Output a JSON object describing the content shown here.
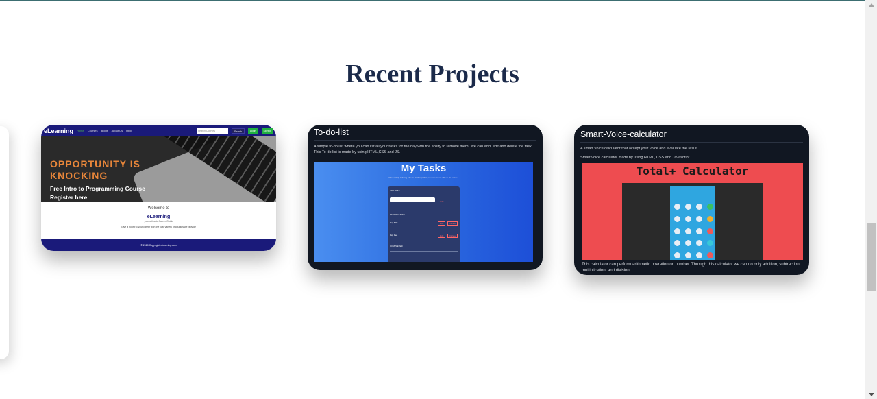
{
  "section": {
    "heading": "Recent Projects"
  },
  "projects": [
    {
      "id": "elearning",
      "screenshot": {
        "logo": "eLearning",
        "nav": [
          "Home",
          "Courses",
          "Blogs",
          "About Us",
          "Help"
        ],
        "search_placeholder": "Search Courses",
        "search_button": "Search",
        "login": "Login",
        "signup": "SignUp",
        "hero_title": "OPPORTUNITY IS KNOCKING",
        "hero_line1": "Free Intro to Programming Course",
        "hero_line2": "Register here",
        "welcome": "Welcome to",
        "brand": "eLearning",
        "tagline": "your ultimate Career Guide",
        "description": "Give a boost to your career with the vast variety of courses we provide",
        "footer": "© 2020 Copyright: eLearning.com"
      }
    },
    {
      "id": "todo",
      "title": "To-do-list",
      "description": "A simple to-do list where you can list all your tasks for the day with the ability to remove them. We can add, edit and delete the task. This To-do list is made by using HTML,CSS and JS.",
      "screenshot": {
        "title": "My Tasks",
        "subtitle": "Productivity is being able to do things that you were never able to do before.",
        "add_label": "ADD TASK",
        "add_button": "Add",
        "pending_label": "PENDING TASK",
        "items": [
          "Pay Bills",
          "Pay Fee"
        ],
        "edit": "Edit",
        "delete": "Delete",
        "completed_label": "COMPLETED"
      }
    },
    {
      "id": "calculator",
      "title": "Smart-Voice-calculator",
      "description": "A smart Voice calculator that accept your voice and evaluate the result.",
      "description2": "Smart voice calculator made by using HTML, CSS and Javascript.",
      "screenshot": {
        "title": "Total+ Calculator"
      },
      "footer_text": "This calculator can perform arithmetic operation on number. Through this calculator we can do only addition, subtraction, multiplication, and division."
    }
  ],
  "colors": {
    "heading": "#1b2a4a",
    "card_dark": "#111722",
    "accent_red": "#ee4c50"
  }
}
